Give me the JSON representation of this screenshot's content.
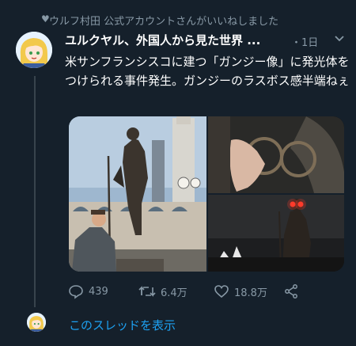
{
  "social_context": {
    "text": "ウルフ村田 公式アカウントさんがいいねしました",
    "icon": "heart-icon"
  },
  "tweet": {
    "author_name": "ユルクヤル、外国人から見た世界 ...",
    "timestamp": "・1日",
    "text": "米サンフランシスコに建つ「ガンジー像」に発光体をつけられる事件発生。ガンジーのラスボス感半端ねぇ",
    "actions": {
      "reply_count": "439",
      "retweet_count": "6.4万",
      "like_count": "18.8万"
    }
  },
  "show_thread": "このスレッドを表示",
  "colors": {
    "background": "#15202b",
    "secondary_text": "#8899a6",
    "accent": "#1da1f2",
    "divider": "#38444d"
  }
}
